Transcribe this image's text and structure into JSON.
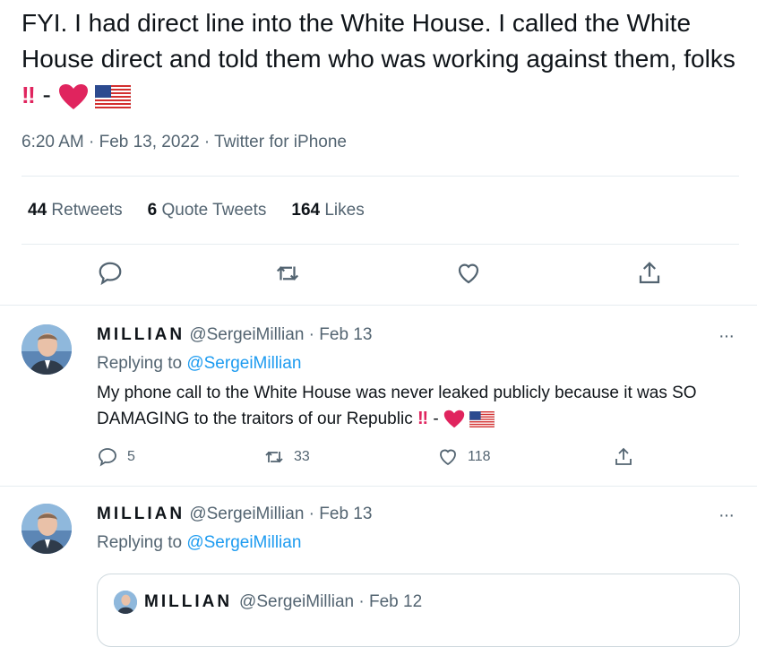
{
  "tweet": {
    "text": "FYI. I had direct line into the White House. I called the White House direct and told them who was working against them, folks",
    "suffix_marks": "‼",
    "dash": "-",
    "time": "6:20 AM · Feb 13, 2022 · Twitter for iPhone",
    "stats": {
      "retweets_count": "44",
      "retweets_label": "Retweets",
      "quotes_count": "6",
      "quotes_label": "Quote Tweets",
      "likes_count": "164",
      "likes_label": "Likes"
    },
    "icons": [
      "reply-icon",
      "retweet-icon",
      "like-icon",
      "share-icon"
    ]
  },
  "replies": [
    {
      "name": "MILLIAN",
      "handle": "@SergeiMillian · Feb 13",
      "replying_prefix": "Replying to",
      "replying_handle": "@SergeiMillian",
      "more": "···",
      "text": "My phone call to the White House was never leaked publicly because it was SO DAMAGING to the traitors of our Republic",
      "marks": "‼",
      "dash": "-",
      "reply_count": "5",
      "retweet_count": "33",
      "like_count": "118"
    },
    {
      "name": "MILLIAN",
      "handle": "@SergeiMillian · Feb 13",
      "replying_prefix": "Replying to",
      "replying_handle": "@SergeiMillian",
      "more": "···"
    }
  ],
  "quote": {
    "name": "MILLIAN",
    "handle": "@SergeiMillian · Feb 12"
  },
  "colors": {
    "text": "#0f1419",
    "muted": "#536471",
    "link": "#1d9bf0",
    "heart": "#e0245e",
    "divider": "#e6ecf0"
  }
}
